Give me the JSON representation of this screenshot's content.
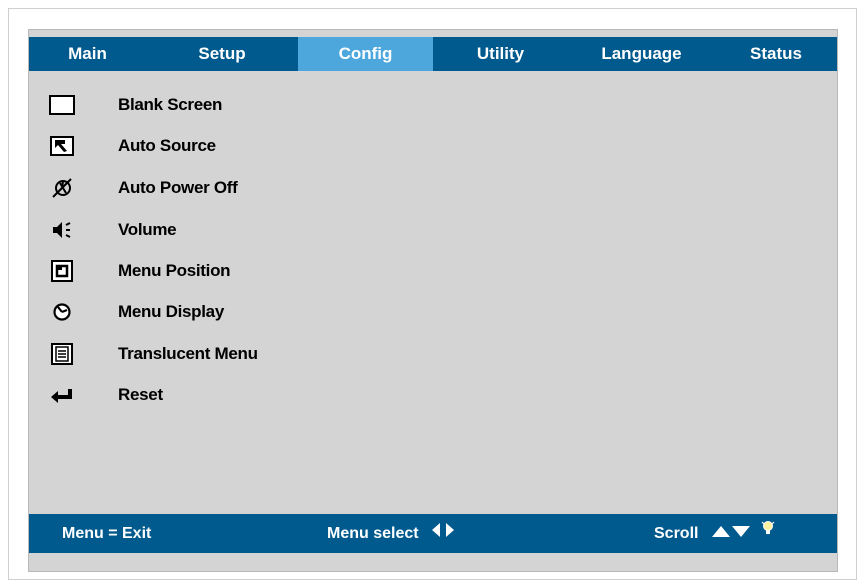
{
  "tabs": [
    {
      "label": "Main",
      "active": false
    },
    {
      "label": "Setup",
      "active": false
    },
    {
      "label": "Config",
      "active": true
    },
    {
      "label": "Utility",
      "active": false
    },
    {
      "label": "Language",
      "active": false
    },
    {
      "label": "Status",
      "active": false
    }
  ],
  "colors": {
    "bar": "#005a8e",
    "active_tab": "#4da7dd",
    "panel": "#d4d4d4"
  },
  "menu_items": [
    {
      "label": "Blank Screen",
      "icon": "blank-screen-icon"
    },
    {
      "label": "Auto Source",
      "icon": "auto-source-icon"
    },
    {
      "label": "Auto Power Off",
      "icon": "auto-power-off-icon"
    },
    {
      "label": "Volume",
      "icon": "volume-icon"
    },
    {
      "label": "Menu Position",
      "icon": "menu-position-icon"
    },
    {
      "label": "Menu Display",
      "icon": "menu-display-icon"
    },
    {
      "label": "Translucent Menu",
      "icon": "translucent-menu-icon"
    },
    {
      "label": "Reset",
      "icon": "reset-icon"
    }
  ],
  "footer": {
    "exit_hint": "Menu = Exit",
    "select_hint": "Menu select",
    "scroll_hint": "Scroll"
  }
}
